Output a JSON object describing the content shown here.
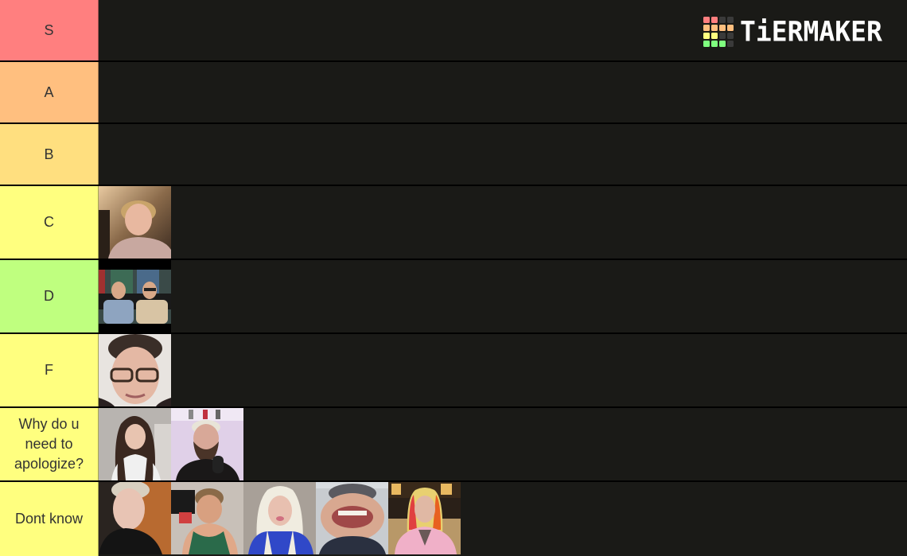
{
  "logo": {
    "text": "TiERMAKER",
    "grid_colors": [
      "#ff7f7f",
      "#ff7f7f",
      "#3a3a3a",
      "#3a3a3a",
      "#ffbf7f",
      "#ffbf7f",
      "#ffbf7f",
      "#ffbf7f",
      "#ffff7f",
      "#ffff7f",
      "#3a3a3a",
      "#3a3a3a",
      "#7fff7f",
      "#7fff7f",
      "#7fff7f",
      "#3a3a3a"
    ]
  },
  "tiers": [
    {
      "label": "S",
      "color": "#ff7f7f",
      "items": []
    },
    {
      "label": "A",
      "color": "#ffbf7f",
      "items": []
    },
    {
      "label": "B",
      "color": "#ffdf7f",
      "items": []
    },
    {
      "label": "C",
      "color": "#ffff7f",
      "items": [
        {
          "name": "blond-man-apology-thumbnail"
        }
      ]
    },
    {
      "label": "D",
      "color": "#bfff7f",
      "items": [
        {
          "name": "two-men-apology-thumbnail"
        }
      ]
    },
    {
      "label": "F",
      "color": "#ffff7f",
      "items": [
        {
          "name": "glasses-young-man-thumbnail"
        }
      ]
    },
    {
      "label": "Why do u need to apologize?",
      "color": "#ffff7f",
      "items": [
        {
          "name": "long-hair-woman-thumbnail"
        },
        {
          "name": "bearded-man-headset-thumbnail"
        }
      ]
    },
    {
      "label": "Dont know",
      "color": "#ffff7f",
      "items": [
        {
          "name": "pale-man-black-shirt-thumbnail"
        },
        {
          "name": "woman-green-top-thumbnail"
        },
        {
          "name": "blonde-woman-blue-shirt-thumbnail"
        },
        {
          "name": "distorted-face-meme-thumbnail"
        },
        {
          "name": "rainbow-hair-pink-robe-thumbnail"
        }
      ]
    }
  ]
}
